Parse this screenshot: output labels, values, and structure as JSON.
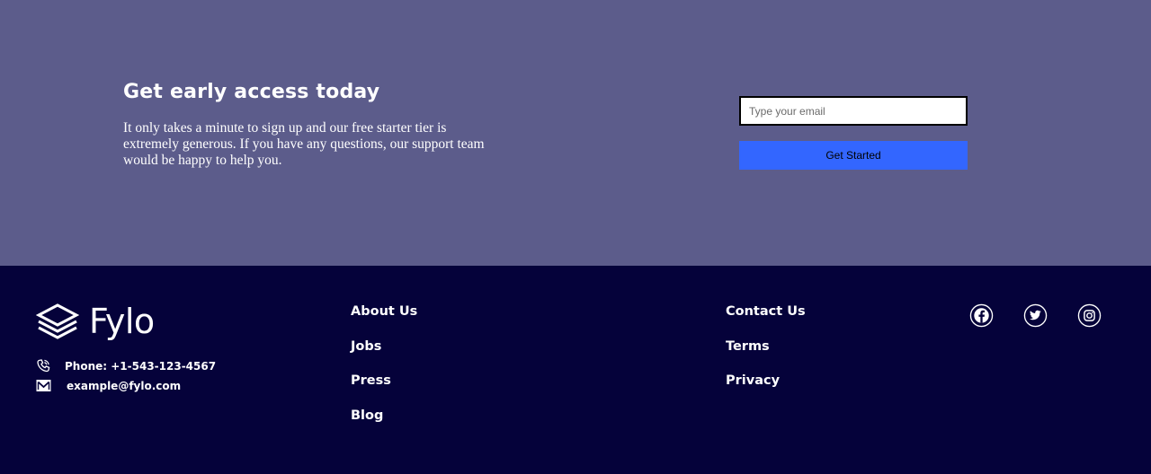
{
  "cta": {
    "title": "Get early access today",
    "text": "It only takes a minute to sign up and our free starter tier is extremely generous. If you have any questions, our support team would be happy to help you.",
    "email_placeholder": "Type your email",
    "button_label": "Get Started",
    "background": "#5c5c8b",
    "button_color": "#3366ff"
  },
  "footer": {
    "background": "#05023a",
    "brand": "Fylo",
    "brand_icon": "layers-logo-icon",
    "phone": "Phone: +1-543-123-4567",
    "phone_icon": "phone-icon",
    "email": "example@fylo.com",
    "email_icon": "mail-icon",
    "links_col1": [
      "About Us",
      "Jobs",
      "Press",
      "Blog"
    ],
    "links_col2": [
      "Contact Us",
      "Terms",
      "Privacy"
    ],
    "socials": [
      "facebook-icon",
      "twitter-icon",
      "instagram-icon"
    ]
  }
}
